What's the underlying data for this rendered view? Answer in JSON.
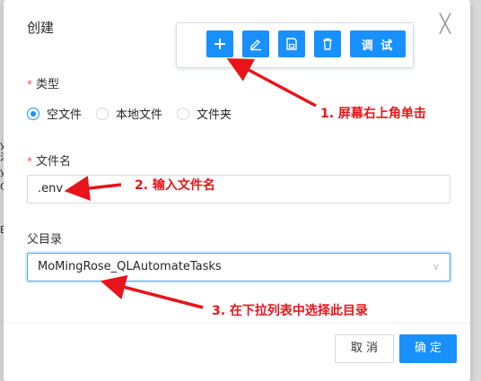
{
  "background": {
    "fragments": [
      "y",
      "沐",
      "y",
      "C",
      "E"
    ]
  },
  "dialog": {
    "title": "创建",
    "close_glyph": "╳",
    "type_field": {
      "required_mark": "*",
      "label": "类型",
      "options": [
        "空文件",
        "本地文件",
        "文件夹"
      ],
      "selected_index": 0
    },
    "filename_field": {
      "required_mark": "*",
      "label": "文件名",
      "value": ".env"
    },
    "parent_field": {
      "label": "父目录",
      "value": "MoMingRose_QLAutomateTasks"
    },
    "footer": {
      "cancel_label": "取 消",
      "ok_label": "确 定"
    }
  },
  "toolbar": {
    "buttons": [
      "plus-icon",
      "edit-icon",
      "save-icon",
      "delete-icon"
    ],
    "debug_label": "调 试"
  },
  "annotations": {
    "step1": "1. 屏幕右上角单击",
    "step2": "2. 输入文件名",
    "step3": "3. 在下拉列表中选择此目录"
  },
  "colors": {
    "primary": "#1890ff",
    "annotation_red": "#e8141a",
    "required_red": "#ff4d4f"
  }
}
